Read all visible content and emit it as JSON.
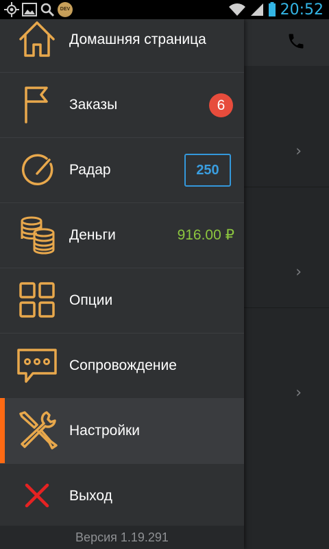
{
  "status_bar": {
    "time": "20:52",
    "left_icons": [
      "gps-icon",
      "image-icon",
      "search-icon",
      "dev-badge-icon"
    ],
    "dev_label": "DEV",
    "right_icons": [
      "wifi-icon",
      "signal-icon",
      "battery-icon"
    ]
  },
  "menu": {
    "items": [
      {
        "label": "Домашняя страница",
        "icon": "home-icon"
      },
      {
        "label": "Заказы",
        "icon": "flag-icon",
        "badge": "6"
      },
      {
        "label": "Радар",
        "icon": "radar-icon",
        "radius": "250"
      },
      {
        "label": "Деньги",
        "icon": "coins-icon",
        "balance": "916.00 ₽"
      },
      {
        "label": "Опции",
        "icon": "grid-icon"
      },
      {
        "label": "Сопровождение",
        "icon": "chat-icon"
      },
      {
        "label": "Настройки",
        "icon": "tools-icon",
        "active": true
      },
      {
        "label": "Выход",
        "icon": "close-icon"
      }
    ],
    "version": "Версия 1.19.291"
  },
  "background": {
    "icons": [
      "phone-icon",
      "chevron-right-icon"
    ],
    "chevron": "›"
  },
  "colors": {
    "icon": "#e8a84c",
    "active_accent": "#ff6a13",
    "badge": "#e74c3c",
    "radar": "#3498db",
    "money": "#8cc63f",
    "exit": "#e62222",
    "status": "#33b5e5"
  }
}
